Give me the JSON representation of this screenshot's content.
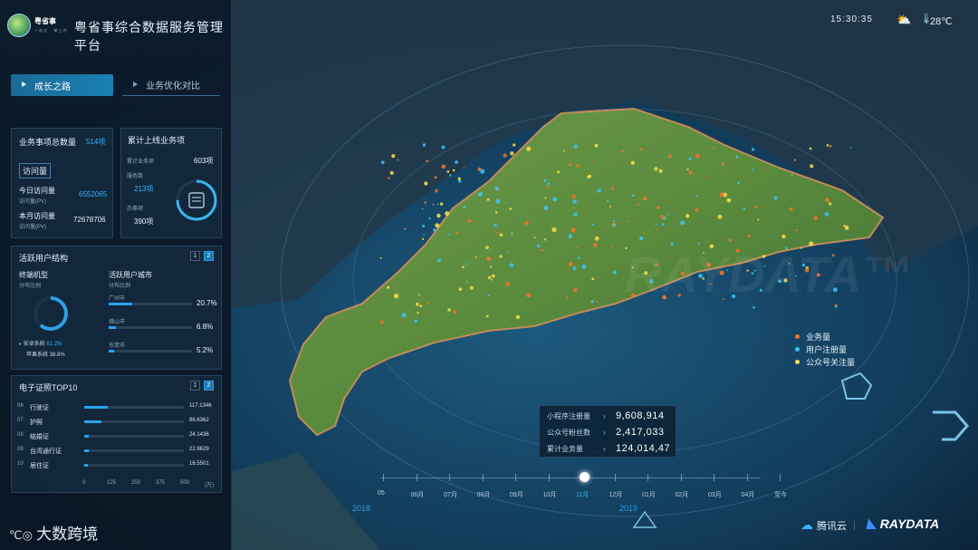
{
  "header": {
    "logo_text": "粤省事",
    "logo_sub": "一站式 · 掌上办",
    "platform_title": "粤省事综合数据服务管理平台",
    "clock": "15:30:35",
    "weather_icon": "partly-cloudy-icon",
    "temperature": "28℃"
  },
  "tabs": [
    {
      "label": "成长之路",
      "active": true
    },
    {
      "label": "业务优化对比",
      "active": false
    }
  ],
  "left": {
    "business_count": {
      "label": "业务事项总数量",
      "value": "514项"
    },
    "visits": {
      "title": "访问量",
      "today_label": "今日访问量",
      "today_sub": "访问量(PV)",
      "today_value": "6552065",
      "month_label": "本月访问量",
      "month_sub": "访问量(PV)",
      "month_value": "72678706"
    },
    "online": {
      "title": "累计上线业务项",
      "total_label": "累计业务项",
      "total_value": "603项",
      "a_label": "服务数",
      "a_value": "213项",
      "b_label": "办事项",
      "b_value": "390项"
    },
    "active_users": {
      "title": "活跃用户结构",
      "pager": [
        "1",
        "2"
      ],
      "model_label": "终端机型",
      "model_sub": "分布比例",
      "legend": [
        {
          "label": "安卓系统",
          "value": "61.2%"
        },
        {
          "label": "苹果系统",
          "value": "38.8%"
        }
      ],
      "donut_fraction": 0.612,
      "region_title": "活跃用户城市",
      "region_sub": "分布比例",
      "regions": [
        {
          "name": "广州市",
          "value": "20.7%",
          "fraction": 0.207
        },
        {
          "name": "佛山市",
          "value": "6.8%",
          "fraction": 0.068
        },
        {
          "name": "东莞市",
          "value": "5.2%",
          "fraction": 0.052
        }
      ]
    },
    "top10": {
      "title": "电子证照TOP10",
      "pager": [
        "1",
        "2"
      ],
      "rows": [
        {
          "rank": "06",
          "name": "行驶证",
          "value": "117.1346",
          "amount": 117.1346
        },
        {
          "rank": "07",
          "name": "护照",
          "value": "86.6362",
          "amount": 86.6362
        },
        {
          "rank": "08",
          "name": "结婚证",
          "value": "24.1436",
          "amount": 24.1436
        },
        {
          "rank": "09",
          "name": "台湾通行证",
          "value": "22.9629",
          "amount": 22.9629
        },
        {
          "rank": "10",
          "name": "居住证",
          "value": "16.5501",
          "amount": 16.5501
        }
      ],
      "axis": [
        "0",
        "125",
        "250",
        "375",
        "500",
        "(万)"
      ],
      "axis_max": 500
    }
  },
  "legend": [
    {
      "label": "业务量",
      "color": "#f2762c"
    },
    {
      "label": "用户注册量",
      "color": "#39c4f5"
    },
    {
      "label": "公众号关注量",
      "color": "#f6e04a"
    }
  ],
  "stats": [
    {
      "label": "小程序注册量",
      "value": "9,608,914"
    },
    {
      "label": "公众号粉丝数",
      "value": "2,417,033"
    },
    {
      "label": "累计业务量",
      "value": "124,014,47"
    }
  ],
  "timeline": {
    "months": [
      "05",
      "06月",
      "07月",
      "08月",
      "09月",
      "10月",
      "11月",
      "12月",
      "01月",
      "02月",
      "03月",
      "04月",
      "至今"
    ],
    "years": [
      "2018",
      "2019"
    ],
    "current": "11月"
  },
  "brand": {
    "left": "大数跨境",
    "tencent": "腾讯云",
    "raydata": "RAYDATA",
    "watermark_a": "腾讯",
    "watermark_b": "RAYDATA™"
  }
}
